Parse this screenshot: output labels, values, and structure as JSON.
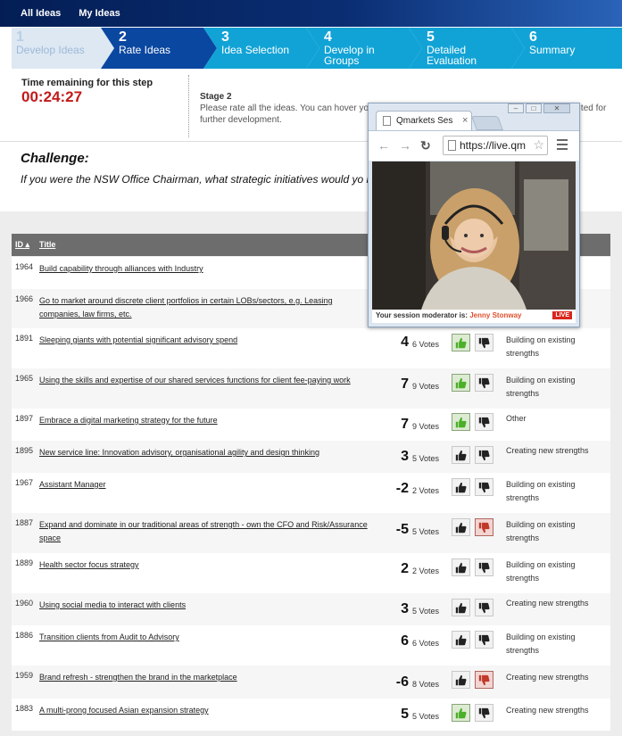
{
  "nav": {
    "all_ideas": "All Ideas",
    "my_ideas": "My Ideas"
  },
  "steps": [
    {
      "num": "1",
      "label": "Develop Ideas"
    },
    {
      "num": "2",
      "label": "Rate Ideas"
    },
    {
      "num": "3",
      "label": "Idea Selection"
    },
    {
      "num": "4",
      "label": "Develop in Groups"
    },
    {
      "num": "5",
      "label": "Detailed Evaluation"
    },
    {
      "num": "6",
      "label": "Summary"
    }
  ],
  "timer": {
    "label": "Time remaining for this step",
    "value": "00:24:27"
  },
  "stage": {
    "title": "Stage 2",
    "text": "Please rate all the ideas. You can hover you                                                   or click on the idea title. When you have finished, w                                                  ted for further development."
  },
  "challenge": {
    "heading": "Challenge:",
    "text": "If you were the NSW Office Chairman, what strategic initiatives would yo                                                   revenue by $90m over the next 4 years?"
  },
  "table": {
    "headers": {
      "id": "ID",
      "title": "Title"
    },
    "rows": [
      {
        "id": "1964",
        "title": "Build capability through alliances with Industry",
        "score": "",
        "votes": "",
        "vote": "none",
        "category": "ths"
      },
      {
        "id": "1966",
        "title": "Go to market around discrete client portfolios in certain LOBs/sectors, e.g. Leasing companies, law firms, etc.",
        "score": "",
        "votes": "",
        "vote": "none",
        "category": ""
      },
      {
        "id": "1891",
        "title": "Sleeping giants with potential significant advisory spend",
        "score": "4",
        "votes": "6 Votes",
        "vote": "up",
        "category": "Building on existing strengths"
      },
      {
        "id": "1965",
        "title": "Using the skills and expertise of our shared services functions for client fee-paying work",
        "score": "7",
        "votes": "9 Votes",
        "vote": "up",
        "category": "Building on existing strengths"
      },
      {
        "id": "1897",
        "title": "Embrace a digital marketing strategy for the future",
        "score": "7",
        "votes": "9 Votes",
        "vote": "up",
        "category": "Other"
      },
      {
        "id": "1895",
        "title": "New service line: Innovation advisory, organisational agility and design thinking",
        "score": "3",
        "votes": "5 Votes",
        "vote": "none",
        "category": "Creating new strengths"
      },
      {
        "id": "1967",
        "title": "Assistant Manager",
        "score": "-2",
        "votes": "2 Votes",
        "vote": "none",
        "category": "Building on existing strengths"
      },
      {
        "id": "1887",
        "title": "Expand and dominate in our traditional areas of strength - own the CFO and Risk/Assurance space",
        "score": "-5",
        "votes": "5 Votes",
        "vote": "down",
        "category": "Building on existing strengths"
      },
      {
        "id": "1889",
        "title": "Health sector focus strategy",
        "score": "2",
        "votes": "2 Votes",
        "vote": "none",
        "category": "Building on existing strengths"
      },
      {
        "id": "1960",
        "title": "Using social media to interact with clients",
        "score": "3",
        "votes": "5 Votes",
        "vote": "none",
        "category": "Creating new strengths"
      },
      {
        "id": "1886",
        "title": "Transition clients from Audit to Advisory",
        "score": "6",
        "votes": "6 Votes",
        "vote": "none",
        "category": "Building on existing strengths"
      },
      {
        "id": "1959",
        "title": "Brand refresh - strengthen the brand in the marketplace",
        "score": "-6",
        "votes": "8 Votes",
        "vote": "down",
        "category": "Creating new strengths"
      },
      {
        "id": "1883",
        "title": "A multi-prong focused Asian expansion strategy",
        "score": "5",
        "votes": "5 Votes",
        "vote": "up",
        "category": "Creating new strengths"
      }
    ]
  },
  "popup": {
    "tab_title": "Qmarkets Ses",
    "url": "https://live.qm",
    "moderator_label": "Your session moderator is:",
    "moderator_name": "Jenny Stonway",
    "live_badge": "LIVE"
  },
  "colors": {
    "nav": "#0a2d72",
    "step_active": "#0a47a0",
    "step": "#1aa3d6",
    "timer": "#c11a1a",
    "live": "#d9261c"
  }
}
